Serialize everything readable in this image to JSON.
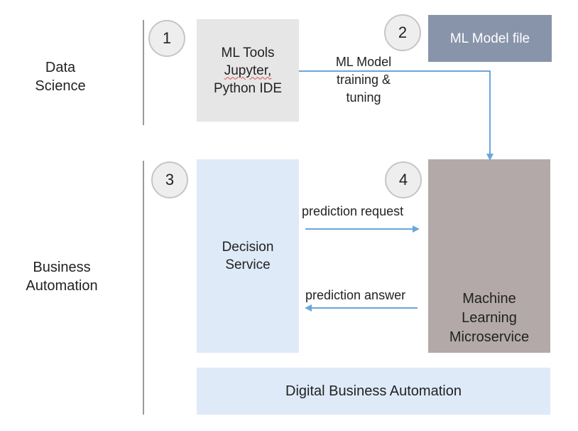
{
  "lanes": {
    "data_science": {
      "line1": "Data",
      "line2": "Science"
    },
    "business_automation": {
      "line1": "Business",
      "line2": "Automation"
    }
  },
  "steps": {
    "step1": "1",
    "step2": "2",
    "step3": "3",
    "step4": "4"
  },
  "boxes": {
    "ml_tools": {
      "line1": "ML Tools",
      "line2": "Jupyter,",
      "line3": "Python IDE"
    },
    "ml_model_file": "ML Model file",
    "decision_service": {
      "line1": "Decision",
      "line2": "Service"
    },
    "ml_microservice": {
      "line1": "Machine",
      "line2": "Learning",
      "line3": "Microservice"
    },
    "digital_business_automation": "Digital Business Automation"
  },
  "edges": {
    "training": {
      "line1": "ML Model",
      "line2": "training &",
      "line3": "tuning"
    },
    "prediction_request": "prediction request",
    "prediction_answer": "prediction answer"
  },
  "colors": {
    "ml_tools_fill": "#e6e6e6",
    "model_file_fill": "#8794aa",
    "decision_fill": "#deeaf7",
    "microservice_fill": "#b3a9a8",
    "dba_fill": "#deeaf7",
    "arrow": "#6aa6db",
    "lane_line": "#9a9a9a"
  }
}
